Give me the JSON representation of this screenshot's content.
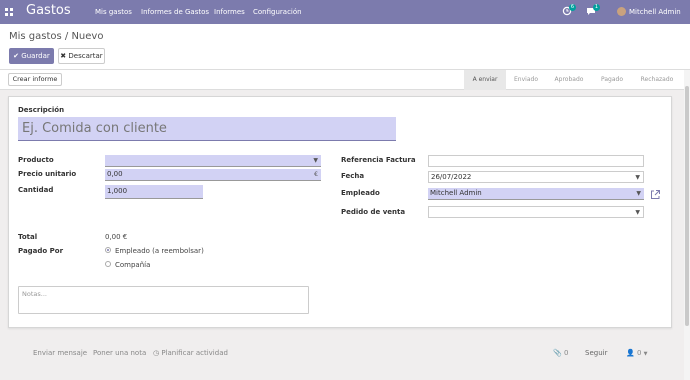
{
  "nav": {
    "app_name": "Gastos",
    "menu": [
      "Mis gastos",
      "Informes de Gastos",
      "Informes",
      "Configuración"
    ],
    "activity_count": "6",
    "message_count": "1",
    "user": "Mitchell Admin"
  },
  "control": {
    "breadcrumb": "Mis gastos / Nuevo",
    "save_label": "Guardar",
    "discard_label": "Descartar"
  },
  "status": {
    "report_button": "Crear informe",
    "stages": [
      "A enviar",
      "Enviado",
      "Aprobado",
      "Pagado",
      "Rechazado"
    ],
    "active_stage": "A enviar"
  },
  "form": {
    "description_label": "Descripción",
    "description_placeholder": "Ej. Comida con cliente",
    "product_label": "Producto",
    "product_value": "",
    "unit_price_label": "Precio unitario",
    "unit_price_value": "0,00",
    "currency_symbol": "€",
    "quantity_label": "Cantidad",
    "quantity_value": "1,000",
    "reference_label": "Referencia Factura",
    "reference_value": "",
    "date_label": "Fecha",
    "date_value": "26/07/2022",
    "employee_label": "Empleado",
    "employee_value": "Mitchell Admin",
    "sale_order_label": "Pedido de venta",
    "sale_order_value": "",
    "total_label": "Total",
    "total_value": "0,00 €",
    "paid_by_label": "Pagado Por",
    "paid_by_options": [
      "Empleado (a reembolsar)",
      "Compañía"
    ],
    "paid_by_selected": "Empleado (a reembolsar)",
    "notes_placeholder": "Notas..."
  },
  "chatter": {
    "send_message": "Enviar mensaje",
    "log_note": "Poner una nota",
    "schedule_activity": "Planificar actividad",
    "attachments_count": "0",
    "follow": "Seguir",
    "followers_count": "0"
  },
  "colors": {
    "brand": "#7c7bad",
    "required_field": "#d2d2f4",
    "badge": "#00a09d"
  }
}
